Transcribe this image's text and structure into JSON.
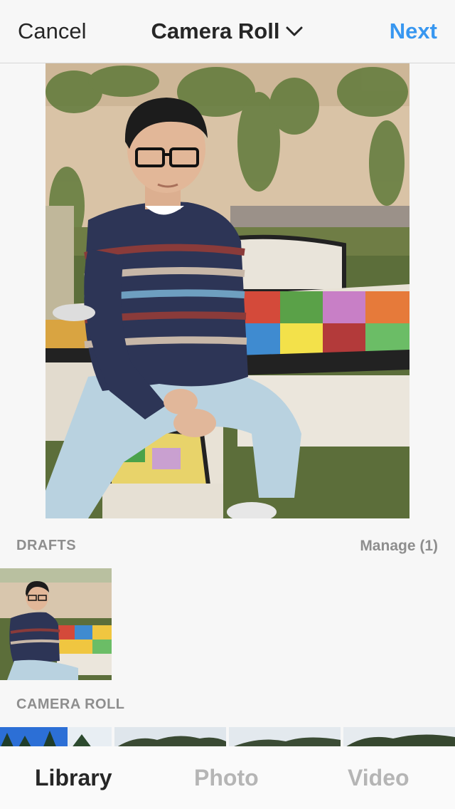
{
  "header": {
    "cancel_label": "Cancel",
    "title": "Camera Roll",
    "next_label": "Next"
  },
  "drafts": {
    "section_label": "DRAFTS",
    "manage_label": "Manage (1)"
  },
  "camera_roll": {
    "section_label": "CAMERA ROLL"
  },
  "tabs": [
    {
      "label": "Library",
      "active": true
    },
    {
      "label": "Photo",
      "active": false
    },
    {
      "label": "Video",
      "active": false
    }
  ],
  "colors": {
    "accent": "#3897f0",
    "text": "#262626",
    "muted": "#8e8e8e",
    "inactive_tab": "#b5b5b5"
  },
  "icons": {
    "title_chevron": "chevron-down-icon"
  }
}
